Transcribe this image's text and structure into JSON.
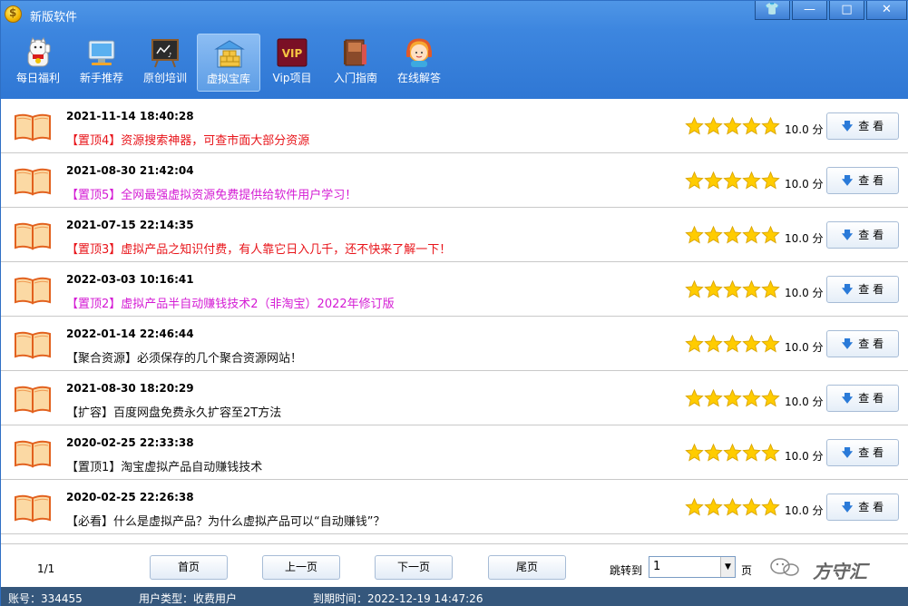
{
  "window": {
    "title": "新版软件",
    "buttons": [
      "👕",
      "—",
      "□",
      "✕"
    ]
  },
  "toolbar": [
    {
      "label": "每日福利",
      "icon": "lucky-cat-icon"
    },
    {
      "label": "新手推荐",
      "icon": "monitor-icon"
    },
    {
      "label": "原创培训",
      "icon": "chalkboard-icon"
    },
    {
      "label": "虚拟宝库",
      "icon": "warehouse-icon",
      "active": true
    },
    {
      "label": "Vip项目",
      "icon": "vip-icon",
      "badge": "VIP"
    },
    {
      "label": "入门指南",
      "icon": "book-stack-icon"
    },
    {
      "label": "在线解答",
      "icon": "support-agent-icon"
    }
  ],
  "list": [
    {
      "date": "2021-11-14 18:40:28",
      "title": "【置顶4】资源搜索神器，可查市面大部分资源",
      "color": "#e8141a",
      "rating": 5,
      "score": "10.0 分",
      "button": "查 看"
    },
    {
      "date": "2021-08-30 21:42:04",
      "title": "【置顶5】全网最强虚拟资源免费提供给软件用户学习！",
      "color": "#d41bd4",
      "rating": 5,
      "score": "10.0 分",
      "button": "查 看"
    },
    {
      "date": "2021-07-15 22:14:35",
      "title": "【置顶3】虚拟产品之知识付费，有人靠它日入几千，还不快来了解一下！",
      "color": "#e8141a",
      "rating": 5,
      "score": "10.0 分",
      "button": "查 看"
    },
    {
      "date": "2022-03-03 10:16:41",
      "title": "【置顶2】虚拟产品半自动赚钱技术2（非淘宝）2022年修订版",
      "color": "#d41bd4",
      "rating": 5,
      "score": "10.0 分",
      "button": "查 看"
    },
    {
      "date": "2022-01-14 22:46:44",
      "title": "【聚合资源】必须保存的几个聚合资源网站！",
      "color": "#111111",
      "rating": 5,
      "score": "10.0 分",
      "button": "查 看"
    },
    {
      "date": "2021-08-30 18:20:29",
      "title": "【扩容】百度网盘免费永久扩容至2T方法",
      "color": "#111111",
      "rating": 5,
      "score": "10.0 分",
      "button": "查 看"
    },
    {
      "date": "2020-02-25 22:33:38",
      "title": "【置顶1】淘宝虚拟产品自动赚钱技术",
      "color": "#111111",
      "rating": 5,
      "score": "10.0 分",
      "button": "查 看"
    },
    {
      "date": "2020-02-25 22:26:38",
      "title": "【必看】什么是虚拟产品？为什么虚拟产品可以“自动赚钱”？",
      "color": "#111111",
      "rating": 5,
      "score": "10.0 分",
      "button": "查 看"
    }
  ],
  "pager": {
    "info": "1/1",
    "first": "首页",
    "prev": "上一页",
    "next": "下一页",
    "last": "尾页",
    "jump_label": "跳转到",
    "jump_value": "1",
    "page_unit": "页",
    "watermark": "方守汇"
  },
  "status": {
    "account": "账号：334455",
    "user_type": "用户类型：收费用户",
    "expire": "到期时间：2022-12-19 14:47:26"
  }
}
